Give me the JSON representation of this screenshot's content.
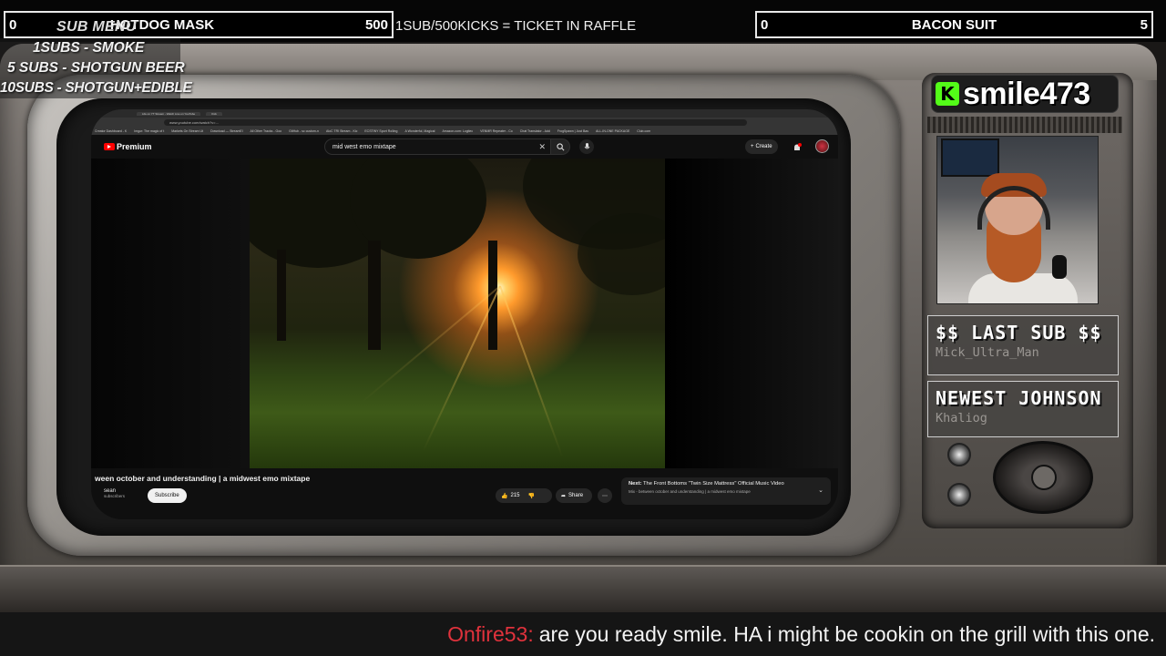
{
  "top_bar": {
    "left_goal": {
      "current": "0",
      "name": "HOTDOG MASK",
      "target": "500"
    },
    "raffle_text": "1SUB/500KICKS = TICKET IN RAFFLE",
    "right_goal": {
      "current": "0",
      "name": "BACON SUIT",
      "target": "5"
    }
  },
  "sub_menu": {
    "title": "SUB MENU",
    "items": [
      "1SUBS  - SMOKE",
      "5 SUBS  - SHOTGUN BEER",
      "10SUBS - SHOTGUN+EDIBLE"
    ]
  },
  "browser": {
    "tabs": [
      "Life on YT Stream - Watch Live on YouTube",
      "Kick"
    ],
    "url": "www.youtube.com/watch?v=...",
    "bookmarks": [
      "Creator Dashboard - K",
      "Imgur: The magic of t",
      "Markets On Stream Ut",
      "Download — StreamEl",
      "All Other Tracks - Goo",
      "GitHub - sc custom-n",
      "AloC TRI Stream - Kic",
      "ECSTINY Sport Rolling",
      "A Wonderful, Magical",
      "Amazon.com: Logitec",
      "VENMR Repeater - Co",
      "Chat Translator - Add",
      "FrogSpawn | Just Bas",
      "ALL-IN-ONE PACKAGE",
      "Club.com"
    ]
  },
  "youtube": {
    "brand": "Premium",
    "search_value": "mid west emo mixtape",
    "create_label": "Create",
    "video_title": "ween october and understanding | a midwest emo mixtape",
    "channel_name": "sean",
    "channel_subs": "subscribers",
    "subscribe_label": "Subscribe",
    "likes": "215",
    "share_label": "Share",
    "next_label": "Next:",
    "next_title": "The Front Bottoms \"Twin Size Mattress\" Official Music Video",
    "next_subtitle": "Mix - between october and understanding | a midwest emo mixtape"
  },
  "streamer": {
    "platform_icon": "kick-logo-icon",
    "name": "smile473"
  },
  "alerts": {
    "last_sub_title": "$$ LAST SUB $$",
    "last_sub_value": "Mick_Ultra_Man",
    "newest_follower_title": "NEWEST JOHNSON",
    "newest_follower_value": "Khaliog"
  },
  "chat": {
    "username": "Onfire53",
    "message": "are you ready smile. HA i might be cookin on the grill with this one."
  },
  "colors": {
    "kick_green": "#53fc18",
    "chat_username": "#e0323c",
    "youtube_red": "#ff0000"
  }
}
